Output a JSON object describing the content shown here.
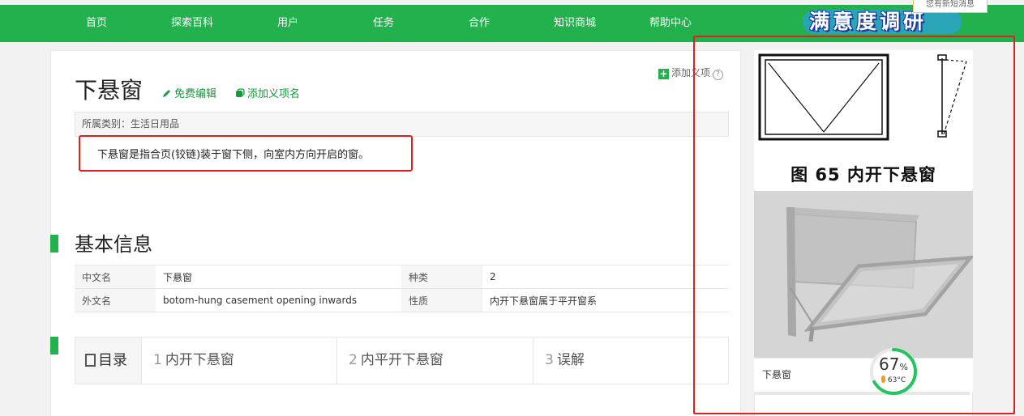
{
  "nav": {
    "items": [
      "首页",
      "探索百科",
      "用户",
      "任务",
      "合作",
      "知识商城",
      "帮助中心"
    ],
    "banner_text": "满意度调研",
    "tip_text": "您有新短消息"
  },
  "entry": {
    "title": "下悬窗",
    "edit_label": "免费编辑",
    "add_sense_label": "添加义项名",
    "add_item_label": "添加义项",
    "help_mark": "?",
    "category_label": "所属类别：",
    "category_value": "生活日用品",
    "summary": "下悬窗是指合页(铰链)装于窗下侧，向室内方向开启的窗。"
  },
  "basic_info": {
    "heading": "基本信息",
    "rows": [
      {
        "k1": "中文名",
        "v1": "下悬窗",
        "k2": "种类",
        "v2": "2"
      },
      {
        "k1": "外文名",
        "v1": "botom-hung casement opening inwards",
        "k2": "性质",
        "v2": "内开下悬窗属于平开窗系"
      }
    ]
  },
  "toc": {
    "label": "目录",
    "items": [
      {
        "num": "1",
        "text": "内开下悬窗"
      },
      {
        "num": "2",
        "text": "内平开下悬窗"
      },
      {
        "num": "3",
        "text": "误解"
      }
    ]
  },
  "side": {
    "diagram_caption": "图 65    内开下悬窗",
    "photo_caption": "下悬窗"
  },
  "widget": {
    "percent": "67",
    "percent_unit": "%",
    "temperature": "63°C",
    "progress_fraction": 0.67,
    "ring_color": "#22c55e"
  },
  "colors": {
    "brand_green": "#22b14c",
    "highlight_red": "#e02020"
  }
}
